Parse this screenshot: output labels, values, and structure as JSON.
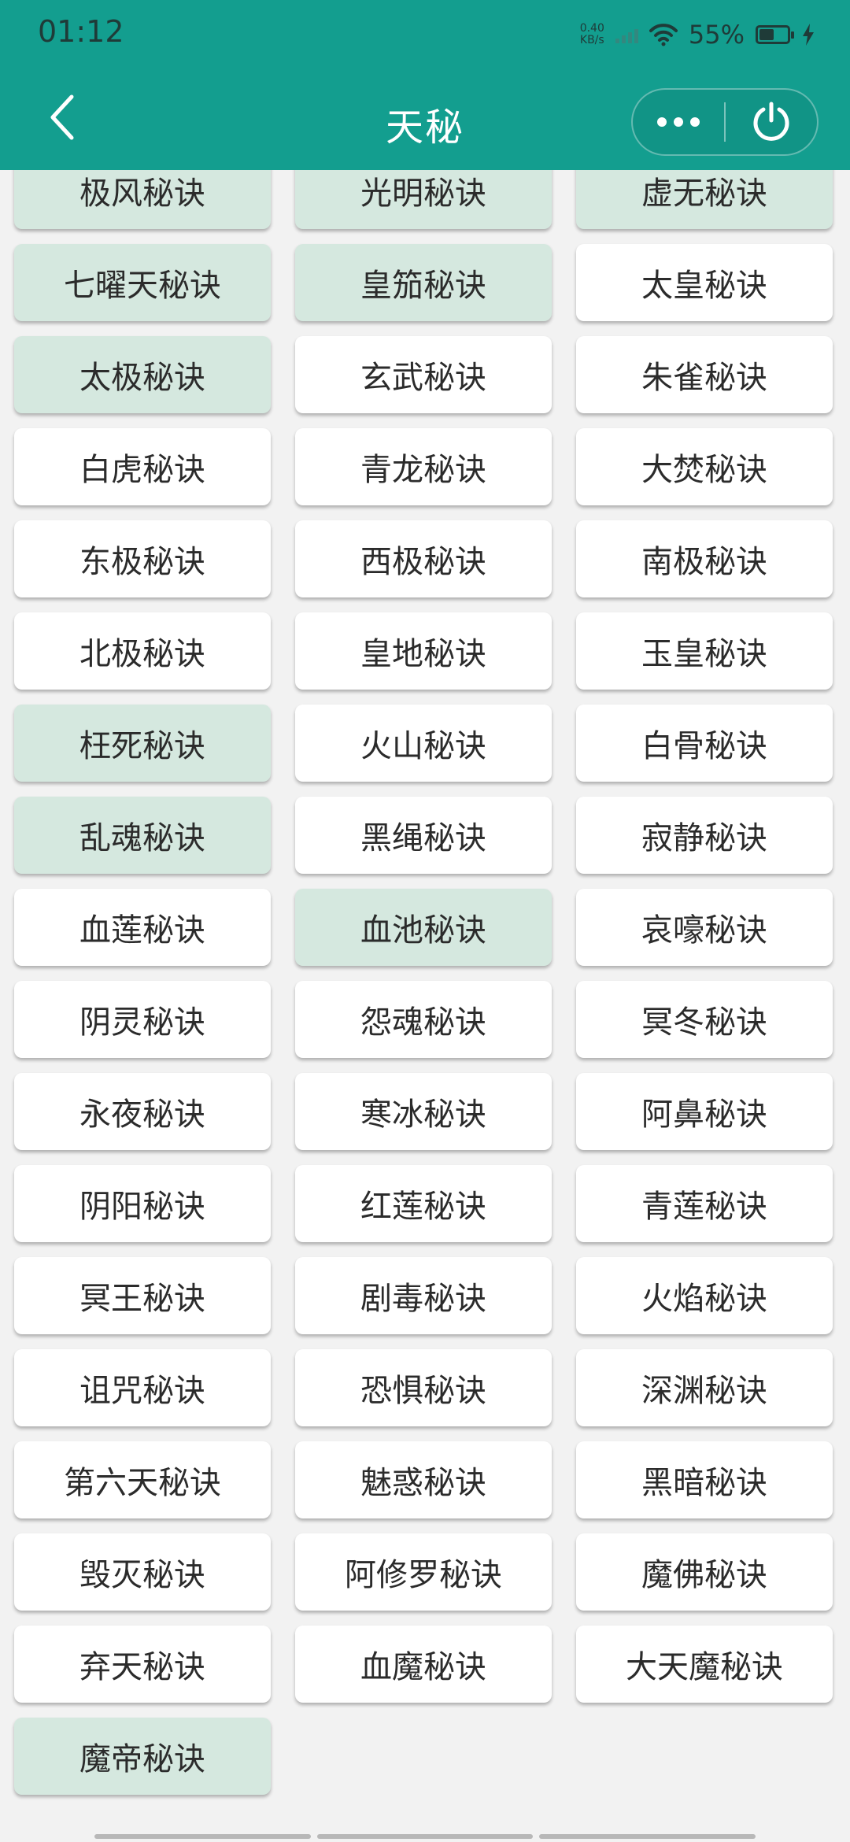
{
  "status_bar": {
    "time": "01:12",
    "net_speed_value": "0.40",
    "net_speed_unit": "KB/s",
    "battery": "55%"
  },
  "navbar": {
    "title": "天秘",
    "back_icon": "chevron-left-icon",
    "more_icon": "more-dots-icon",
    "power_icon": "power-icon"
  },
  "colors": {
    "header": "#139e8f",
    "button_active": "#d5e8df",
    "button_default": "#ffffff"
  },
  "items": [
    {
      "label": "",
      "active": true
    },
    {
      "label": "",
      "active": true
    },
    {
      "label": "",
      "active": true
    },
    {
      "label": "极风秘诀",
      "active": true
    },
    {
      "label": "光明秘诀",
      "active": true
    },
    {
      "label": "虚无秘诀",
      "active": true
    },
    {
      "label": "七曜天秘诀",
      "active": true
    },
    {
      "label": "皇笳秘诀",
      "active": true
    },
    {
      "label": "太皇秘诀",
      "active": false
    },
    {
      "label": "太极秘诀",
      "active": true
    },
    {
      "label": "玄武秘诀",
      "active": false
    },
    {
      "label": "朱雀秘诀",
      "active": false
    },
    {
      "label": "白虎秘诀",
      "active": false
    },
    {
      "label": "青龙秘诀",
      "active": false
    },
    {
      "label": "大焚秘诀",
      "active": false
    },
    {
      "label": "东极秘诀",
      "active": false
    },
    {
      "label": "西极秘诀",
      "active": false
    },
    {
      "label": "南极秘诀",
      "active": false
    },
    {
      "label": "北极秘诀",
      "active": false
    },
    {
      "label": "皇地秘诀",
      "active": false
    },
    {
      "label": "玉皇秘诀",
      "active": false
    },
    {
      "label": "枉死秘诀",
      "active": true
    },
    {
      "label": "火山秘诀",
      "active": false
    },
    {
      "label": "白骨秘诀",
      "active": false
    },
    {
      "label": "乱魂秘诀",
      "active": true
    },
    {
      "label": "黑绳秘诀",
      "active": false
    },
    {
      "label": "寂静秘诀",
      "active": false
    },
    {
      "label": "血莲秘诀",
      "active": false
    },
    {
      "label": "血池秘诀",
      "active": true
    },
    {
      "label": "哀嚎秘诀",
      "active": false
    },
    {
      "label": "阴灵秘诀",
      "active": false
    },
    {
      "label": "怨魂秘诀",
      "active": false
    },
    {
      "label": "冥冬秘诀",
      "active": false
    },
    {
      "label": "永夜秘诀",
      "active": false
    },
    {
      "label": "寒冰秘诀",
      "active": false
    },
    {
      "label": "阿鼻秘诀",
      "active": false
    },
    {
      "label": "阴阳秘诀",
      "active": false
    },
    {
      "label": "红莲秘诀",
      "active": false
    },
    {
      "label": "青莲秘诀",
      "active": false
    },
    {
      "label": "冥王秘诀",
      "active": false
    },
    {
      "label": "剧毒秘诀",
      "active": false
    },
    {
      "label": "火焰秘诀",
      "active": false
    },
    {
      "label": "诅咒秘诀",
      "active": false
    },
    {
      "label": "恐惧秘诀",
      "active": false
    },
    {
      "label": "深渊秘诀",
      "active": false
    },
    {
      "label": "第六天秘诀",
      "active": false
    },
    {
      "label": "魅惑秘诀",
      "active": false
    },
    {
      "label": "黑暗秘诀",
      "active": false
    },
    {
      "label": "毁灭秘诀",
      "active": false
    },
    {
      "label": "阿修罗秘诀",
      "active": false
    },
    {
      "label": "魔佛秘诀",
      "active": false
    },
    {
      "label": "弃天秘诀",
      "active": false
    },
    {
      "label": "血魔秘诀",
      "active": false
    },
    {
      "label": "大天魔秘诀",
      "active": false
    },
    {
      "label": "魔帝秘诀",
      "active": true
    }
  ]
}
